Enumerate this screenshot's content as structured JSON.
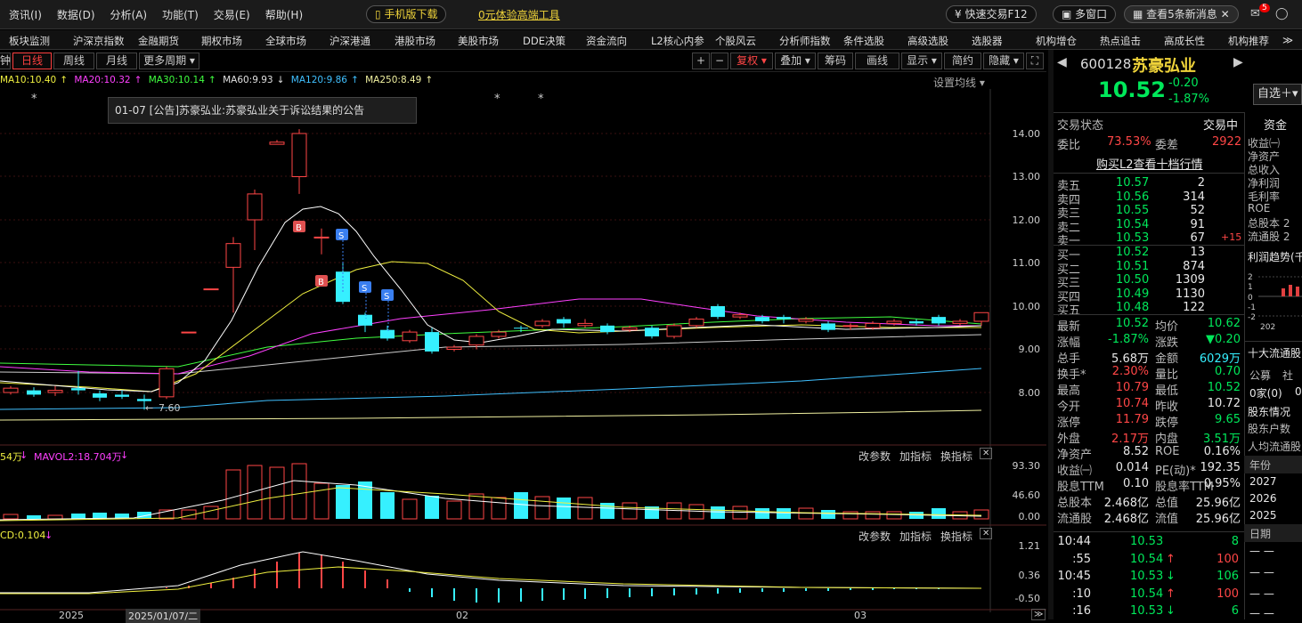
{
  "menu": [
    "资讯(I)",
    "数据(D)",
    "分析(A)",
    "功能(T)",
    "交易(E)",
    "帮助(H)"
  ],
  "topbar": {
    "mobile_btn": "手机版下载",
    "free_tool": "0元体验高端工具",
    "quick_trade": "快速交易F12",
    "multi_window": "多窗口",
    "news": "查看5条新消息",
    "badge": "5"
  },
  "nav": [
    "板块监测",
    "沪深京指数",
    "金融期货",
    "期权市场",
    "全球市场",
    "沪深港通",
    "港股市场",
    "美股市场",
    "DDE决策",
    "资金流向",
    "L2核心内参",
    "个股风云",
    "分析师指数",
    "条件选股",
    "高级选股",
    "选股器",
    "机构增仓",
    "热点追击",
    "高成长性",
    "机构推荐"
  ],
  "chart_tabs": {
    "min": "钟",
    "day": "日线",
    "week": "周线",
    "month": "月线",
    "more": "更多周期"
  },
  "chart_tools": {
    "plus": "+",
    "minus": "−",
    "fuquan": "复权",
    "overlay": "叠加",
    "chips": "筹码",
    "draw": "画线",
    "display": "显示",
    "simple": "简约",
    "hide": "隐藏"
  },
  "ma_legend": {
    "ma10": "MA10:10.40",
    "ma20": "MA20:10.32",
    "ma30": "MA30:10.14",
    "ma60": "MA60:9.93",
    "ma120": "MA120:9.86",
    "ma250": "MA250:8.49",
    "settings": "设置均线"
  },
  "notice": "01-07 [公告]苏豪弘业:苏豪弘业关于诉讼结果的公告",
  "price_axis": [
    "14.00",
    "13.00",
    "12.00",
    "11.00",
    "10.00",
    "9.00",
    "8.00"
  ],
  "low_label": "7.60",
  "vol_legend": {
    "prefix": "54万",
    "mavol2": "MAVOL2:18.704万",
    "tools": [
      "改参数",
      "加指标",
      "换指标"
    ]
  },
  "vol_axis": [
    "93.30",
    "46.60",
    "0.00"
  ],
  "macd_legend": {
    "text": "CD:0.104",
    "tools": [
      "改参数",
      "加指标",
      "换指标"
    ]
  },
  "macd_axis": [
    "1.21",
    "0.36",
    "-0.50"
  ],
  "date_axis": {
    "year": "2025",
    "cursor": "2025/01/07/二",
    "m2": "02",
    "m3": "03"
  },
  "colors": {
    "up": "#ff4646",
    "down": "#36f0ff",
    "ma5": "#ffffff",
    "ma10": "#f0f040",
    "ma20": "#ff40ff",
    "ma30": "#40ff40",
    "ma60": "#40c0ff",
    "ma250": "#f0f0a0"
  },
  "stock": {
    "code": "600128",
    "name": "苏豪弘业",
    "price": "10.52",
    "change": "-0.20",
    "pct": "-1.87%",
    "zixuan": "自选"
  },
  "status": {
    "label": "交易状态",
    "value": "交易中"
  },
  "weibi": {
    "label": "委比",
    "value": "73.53%",
    "label2": "委差",
    "value2": "2922"
  },
  "l2_link": "购买L2查看十档行情",
  "asks": [
    {
      "l": "卖五",
      "p": "10.57",
      "v": "2"
    },
    {
      "l": "卖四",
      "p": "10.56",
      "v": "314"
    },
    {
      "l": "卖三",
      "p": "10.55",
      "v": "52"
    },
    {
      "l": "卖二",
      "p": "10.54",
      "v": "91"
    },
    {
      "l": "卖一",
      "p": "10.53",
      "v": "67",
      "x": "+15"
    }
  ],
  "bids": [
    {
      "l": "买一",
      "p": "10.52",
      "v": "13"
    },
    {
      "l": "买二",
      "p": "10.51",
      "v": "874"
    },
    {
      "l": "买三",
      "p": "10.50",
      "v": "1309"
    },
    {
      "l": "买四",
      "p": "10.49",
      "v": "1130"
    },
    {
      "l": "买五",
      "p": "10.48",
      "v": "122"
    }
  ],
  "quote": [
    [
      "最新",
      "10.52",
      "均价",
      "10.62"
    ],
    [
      "涨幅",
      "-1.87%",
      "涨跌",
      "▼0.20"
    ],
    [
      "总手",
      "5.68万",
      "金额",
      "6029万"
    ],
    [
      "换手*",
      "2.30%",
      "量比",
      "0.70"
    ],
    [
      "最高",
      "10.79",
      "最低",
      "10.52"
    ],
    [
      "今开",
      "10.74",
      "昨收",
      "10.72"
    ],
    [
      "涨停",
      "11.79",
      "跌停",
      "9.65"
    ],
    [
      "外盘",
      "2.17万",
      "内盘",
      "3.51万"
    ],
    [
      "净资产",
      "8.52",
      "ROE",
      "0.16%"
    ],
    [
      "收益㈠",
      "0.014",
      "PE(动)*",
      "192.35"
    ],
    [
      "股息TTM",
      "0.10",
      "股息率TTM",
      "0.95%"
    ],
    [
      "总股本",
      "2.468亿",
      "总值",
      "25.96亿"
    ],
    [
      "流通股",
      "2.468亿",
      "流值",
      "25.96亿"
    ]
  ],
  "ticks": [
    {
      "t": "10:44",
      "p": "10.53",
      "a": "",
      "v": "8"
    },
    {
      "t": ":55",
      "p": "10.54",
      "a": "↑",
      "v": "100"
    },
    {
      "t": "10:45",
      "p": "10.53",
      "a": "↓",
      "v": "106"
    },
    {
      "t": ":10",
      "p": "10.54",
      "a": "↑",
      "v": "100"
    },
    {
      "t": ":16",
      "p": "10.53",
      "a": "↓",
      "v": "6"
    }
  ],
  "fin": {
    "title": "资金",
    "items": [
      "收益㈠",
      "净资产",
      "总收入",
      "净利润",
      "毛利率",
      "ROE",
      "总股本 2",
      "流通股 2"
    ],
    "profit": "利润趋势(千",
    "yr": "202",
    "top10": "十大流通股",
    "pub": "公募",
    "pub2": "社",
    "count": "0家(0)",
    "count2": "0",
    "holders": "股东情况",
    "holdercount": "股东户数",
    "per": "人均流通股",
    "year_hdr": "年份",
    "years": [
      "2027",
      "2026",
      "2025"
    ],
    "date_hdr": "日期",
    "dashes": [
      "— —",
      "— —",
      "— —",
      "— —"
    ]
  }
}
